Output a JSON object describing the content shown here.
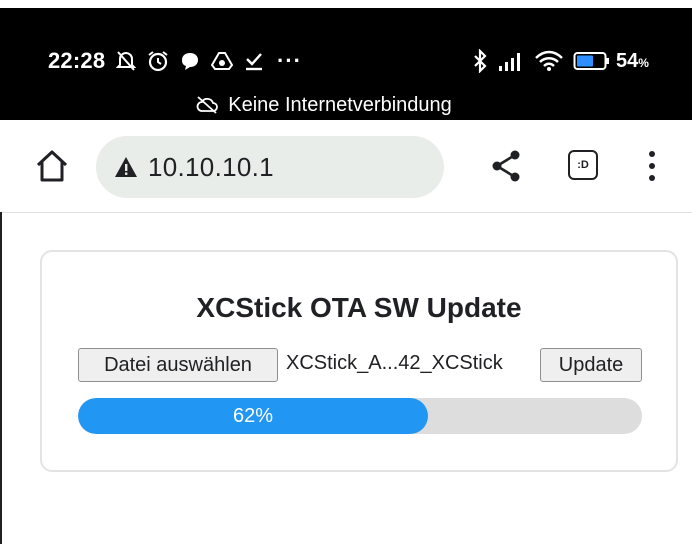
{
  "status_bar": {
    "time": "22:28",
    "left_icons": [
      "bell-muted-icon",
      "alarm-icon",
      "chat-bubble-icon",
      "drive-icon",
      "download-done-icon"
    ],
    "overflow": "···",
    "right_icons": [
      "bluetooth-icon",
      "signal-icon",
      "wifi-icon",
      "battery-icon"
    ],
    "battery_percent": "54",
    "battery_unit": "%",
    "offline_text": "Keine Internetverbindung"
  },
  "browser": {
    "url": "10.10.10.1",
    "tab_count_label": ":D"
  },
  "page": {
    "title": "XCStick OTA SW Update",
    "file_button_label": "Datei auswählen",
    "selected_file": "XCStick_A...42_XCStick",
    "update_button_label": "Update",
    "progress_value": 0.62,
    "progress_label": "62%",
    "accent_color": "#2196f3"
  }
}
